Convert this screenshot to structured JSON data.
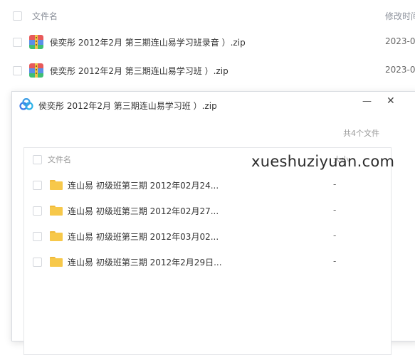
{
  "background_list": {
    "header": {
      "name_label": "文件名",
      "date_label": "修改时间"
    },
    "rows": [
      {
        "name": "侯奕彤 2012年2月  第三期连山易学习班录音  ）.zip",
        "date": "2023-0"
      },
      {
        "name": "侯奕彤 2012年2月  第三期连山易学习班  ）.zip",
        "date": "2023-0"
      }
    ]
  },
  "dialog": {
    "title": "侯奕彤 2012年2月  第三期连山易学习班  ）.zip",
    "minimize_symbol": "—",
    "close_symbol": "✕",
    "count": "共4个文件",
    "table": {
      "header": {
        "name_label": "文件名",
        "size_label": "大小"
      },
      "rows": [
        {
          "name": "连山易 初级班第三期 2012年02月24...",
          "size": "-"
        },
        {
          "name": "连山易 初级班第三期 2012年02月27...",
          "size": "-"
        },
        {
          "name": "连山易 初级班第三期 2012年03月02...",
          "size": "-"
        },
        {
          "name": "连山易 初级班第三期 2012年2月29日...",
          "size": "-"
        }
      ]
    }
  },
  "watermark": "xueshuziyuan.com",
  "colors": {
    "folder": "#f7c84a",
    "app_blue": "#3b7ae6",
    "border": "#d9dce1"
  }
}
